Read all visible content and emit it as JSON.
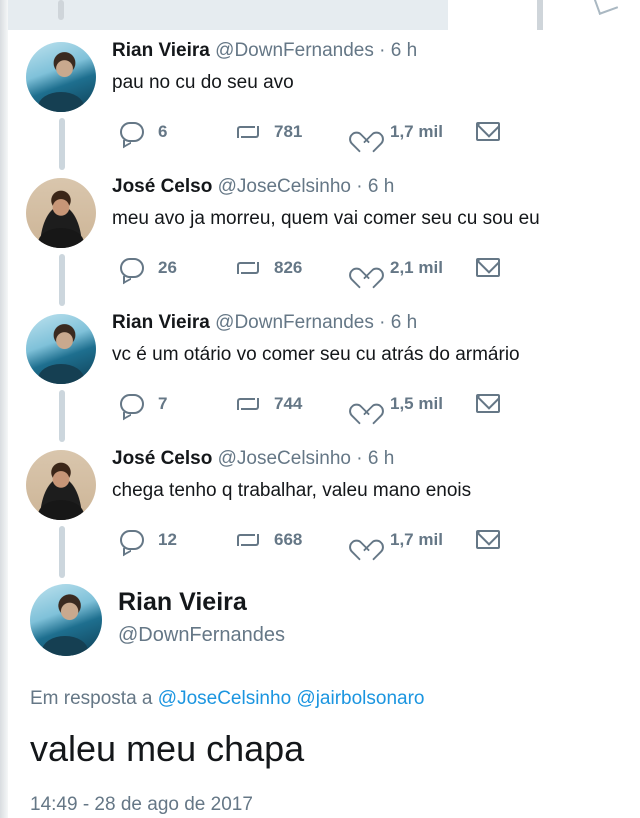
{
  "thread": [
    {
      "name": "Rian Vieira",
      "handle": "@DownFernandes",
      "time": "6 h",
      "text": "pau no cu do seu avo",
      "replies": "6",
      "retweets": "781",
      "likes": "1,7 mil"
    },
    {
      "name": "José Celso",
      "handle": "@JoseCelsinho",
      "time": "6 h",
      "text": "meu avo ja morreu, quem vai comer seu cu sou eu",
      "replies": "26",
      "retweets": "826",
      "likes": "2,1 mil"
    },
    {
      "name": "Rian Vieira",
      "handle": "@DownFernandes",
      "time": "6 h",
      "text": "vc é um otário vo comer seu cu atrás do armário",
      "replies": "7",
      "retweets": "744",
      "likes": "1,5 mil"
    },
    {
      "name": "José Celso",
      "handle": "@JoseCelsinho",
      "time": "6 h",
      "text": "chega tenho q trabalhar, valeu mano enois",
      "replies": "12",
      "retweets": "668",
      "likes": "1,7 mil"
    }
  ],
  "separator": "·",
  "main_tweet": {
    "name": "Rian Vieira",
    "handle": "@DownFernandes",
    "replying_prefix": "Em resposta a",
    "replying_to": [
      "@JoseCelsinho",
      "@jairbolsonaro"
    ],
    "text": "valeu meu chapa",
    "timestamp": "14:49 - 28 de ago de 2017"
  },
  "colors": {
    "text": "#14171a",
    "muted": "#657786",
    "link": "#1b95e0",
    "thread_line": "#ccd6dd"
  },
  "icons": [
    "reply-icon",
    "retweet-icon",
    "heart-icon",
    "mail-icon"
  ]
}
